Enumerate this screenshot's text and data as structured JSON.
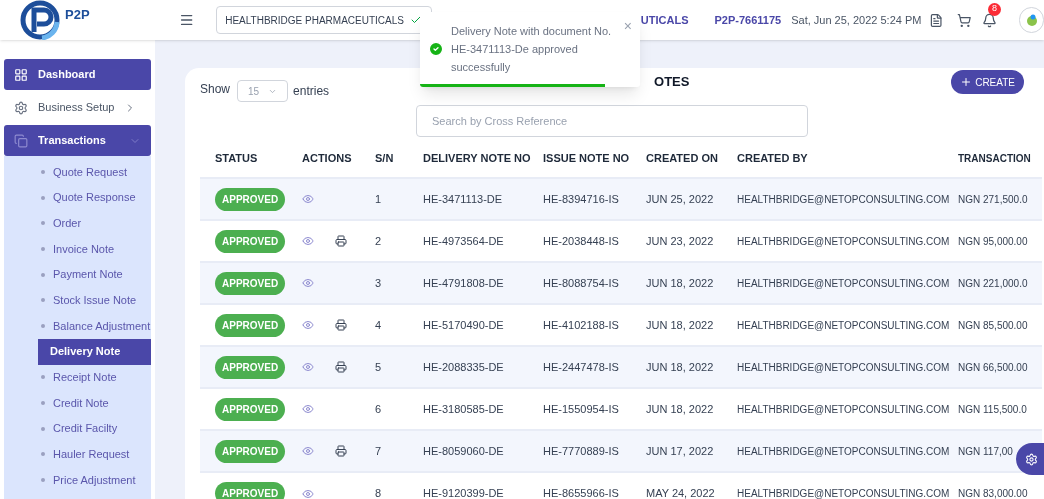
{
  "header": {
    "logo_text": "P2P",
    "company": "HEALTHBRIDGE PHARMACEUTICALS",
    "company_fragment": "UTICALS",
    "account_id": "P2P-7661175",
    "datetime": "Sat, Jun 25, 2022 5:24 PM",
    "notification_count": "8"
  },
  "toast": {
    "message": "Delivery Note with document No. HE-3471113-De approved successfully",
    "close": "×",
    "level": 0.84
  },
  "sidebar": {
    "items": [
      {
        "label": "Dashboard",
        "active": true
      },
      {
        "label": "Business Setup",
        "active": false,
        "expanded": false
      },
      {
        "label": "Transactions",
        "active": true,
        "expanded": true,
        "children": [
          {
            "label": "Quote Request",
            "selected": false
          },
          {
            "label": "Quote Response",
            "selected": false
          },
          {
            "label": "Order",
            "selected": false
          },
          {
            "label": "Invoice Note",
            "selected": false
          },
          {
            "label": "Payment Note",
            "selected": false
          },
          {
            "label": "Stock Issue Note",
            "selected": false
          },
          {
            "label": "Balance Adjustment",
            "selected": false
          },
          {
            "label": "Delivery Note",
            "selected": true
          },
          {
            "label": "Receipt Note",
            "selected": false
          },
          {
            "label": "Credit Note",
            "selected": false
          },
          {
            "label": "Credit Facilty",
            "selected": false
          },
          {
            "label": "Hauler Request",
            "selected": false
          },
          {
            "label": "Price Adjustment",
            "selected": false
          }
        ]
      }
    ]
  },
  "card": {
    "title_fragment": "OTES",
    "show_label": "Show",
    "page_size": "15",
    "entries_label": "entries",
    "create_button": "CREATE",
    "search": {
      "placeholder": "Search by Cross Reference"
    }
  },
  "table": {
    "columns": [
      "STATUS",
      "ACTIONS",
      "S/N",
      "DELIVERY NOTE NO",
      "ISSUE NOTE NO",
      "CREATED ON",
      "CREATED BY",
      "TRANSACTION"
    ],
    "rows": [
      {
        "status": "APPROVED",
        "printable": false,
        "sn": "1",
        "delivery_note_no": "HE-3471113-DE",
        "issue_note_no": "HE-8394716-IS",
        "created_on": "JUN 25, 2022",
        "created_by": "HEALTHBRIDGE@NETOPCONSULTING.COM",
        "transaction": "NGN 271,500.0"
      },
      {
        "status": "APPROVED",
        "printable": true,
        "sn": "2",
        "delivery_note_no": "HE-4973564-DE",
        "issue_note_no": "HE-2038448-IS",
        "created_on": "JUN 23, 2022",
        "created_by": "HEALTHBRIDGE@NETOPCONSULTING.COM",
        "transaction": "NGN 95,000.00"
      },
      {
        "status": "APPROVED",
        "printable": false,
        "sn": "3",
        "delivery_note_no": "HE-4791808-DE",
        "issue_note_no": "HE-8088754-IS",
        "created_on": "JUN 18, 2022",
        "created_by": "HEALTHBRIDGE@NETOPCONSULTING.COM",
        "transaction": "NGN 221,000.0"
      },
      {
        "status": "APPROVED",
        "printable": true,
        "sn": "4",
        "delivery_note_no": "HE-5170490-DE",
        "issue_note_no": "HE-4102188-IS",
        "created_on": "JUN 18, 2022",
        "created_by": "HEALTHBRIDGE@NETOPCONSULTING.COM",
        "transaction": "NGN 85,500.00"
      },
      {
        "status": "APPROVED",
        "printable": true,
        "sn": "5",
        "delivery_note_no": "HE-2088335-DE",
        "issue_note_no": "HE-2447478-IS",
        "created_on": "JUN 18, 2022",
        "created_by": "HEALTHBRIDGE@NETOPCONSULTING.COM",
        "transaction": "NGN 66,500.00"
      },
      {
        "status": "APPROVED",
        "printable": false,
        "sn": "6",
        "delivery_note_no": "HE-3180585-DE",
        "issue_note_no": "HE-1550954-IS",
        "created_on": "JUN 18, 2022",
        "created_by": "HEALTHBRIDGE@NETOPCONSULTING.COM",
        "transaction": "NGN 115,500.0"
      },
      {
        "status": "APPROVED",
        "printable": true,
        "sn": "7",
        "delivery_note_no": "HE-8059060-DE",
        "issue_note_no": "HE-7770889-IS",
        "created_on": "JUN 17, 2022",
        "created_by": "HEALTHBRIDGE@NETOPCONSULTING.COM",
        "transaction": "NGN 117,00"
      },
      {
        "status": "APPROVED",
        "printable": false,
        "sn": "8",
        "delivery_note_no": "HE-9120399-DE",
        "issue_note_no": "HE-8655966-IS",
        "created_on": "MAY 24, 2022",
        "created_by": "HEALTHBRIDGE@NETOPCONSULTING.COM",
        "transaction": "NGN 83,000.00"
      }
    ]
  }
}
